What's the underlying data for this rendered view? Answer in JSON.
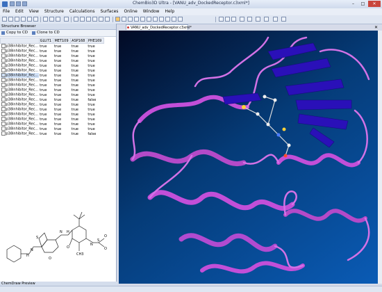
{
  "window": {
    "title": "ChemBio3D Ultra - [VANU_adv_DockedReceptor.c3xml*]"
  },
  "window_controls": {
    "minimize": "–",
    "maximize": "□",
    "close": "✕"
  },
  "menu": [
    "File",
    "Edit",
    "View",
    "Structure",
    "Calculations",
    "Surfaces",
    "Online",
    "Window",
    "Help"
  ],
  "structure_browser": {
    "title": "Structure Browser",
    "copy_to_cd": "Copy to CD",
    "clone_to_cd": "Clone to CD",
    "columns": [
      "",
      "GLU71",
      "MET109",
      "ASP168",
      "PHE169"
    ],
    "rows": [
      {
        "name": "p38inhibitor_Rec...",
        "v": [
          "true",
          "true",
          "true",
          "true"
        ]
      },
      {
        "name": "p38inhibitor_Rec...",
        "v": [
          "true",
          "true",
          "true",
          "true"
        ]
      },
      {
        "name": "p38inhibitor_Rec...",
        "v": [
          "true",
          "true",
          "true",
          "true"
        ]
      },
      {
        "name": "p38inhibitor_Rec...",
        "v": [
          "true",
          "true",
          "true",
          "true"
        ]
      },
      {
        "name": "p38inhibitor_Rec...",
        "v": [
          "true",
          "true",
          "true",
          "true"
        ]
      },
      {
        "name": "p38inhibitor_Rec...",
        "v": [
          "true",
          "true",
          "true",
          "true"
        ]
      },
      {
        "name": "p38inhibitor_Rec...",
        "v": [
          "true",
          "true",
          "true",
          "true"
        ]
      },
      {
        "name": "p38inhibitor_Rec...",
        "v": [
          "true",
          "true",
          "true",
          "true"
        ]
      },
      {
        "name": "p38inhibitor_Rec...",
        "v": [
          "true",
          "true",
          "true",
          "true"
        ]
      },
      {
        "name": "p38inhibitor_Rec...",
        "v": [
          "true",
          "true",
          "true",
          "true"
        ]
      },
      {
        "name": "p38inhibitor_Rec...",
        "v": [
          "true",
          "true",
          "true",
          "true"
        ]
      },
      {
        "name": "p38inhibitor_Rec...",
        "v": [
          "true",
          "true",
          "true",
          "false"
        ]
      },
      {
        "name": "p38inhibitor_Rec...",
        "v": [
          "true",
          "true",
          "true",
          "true"
        ]
      },
      {
        "name": "p38inhibitor_Rec...",
        "v": [
          "true",
          "true",
          "true",
          "true"
        ]
      },
      {
        "name": "p38inhibitor_Rec...",
        "v": [
          "true",
          "true",
          "true",
          "true"
        ]
      },
      {
        "name": "p38inhibitor_Rec...",
        "v": [
          "true",
          "true",
          "true",
          "true"
        ]
      },
      {
        "name": "p38inhibitor_Rec...",
        "v": [
          "true",
          "true",
          "true",
          "true"
        ]
      },
      {
        "name": "p38inhibitor_Rec...",
        "v": [
          "true",
          "true",
          "true",
          "true"
        ]
      },
      {
        "name": "p38inhibitor_Rec...",
        "v": [
          "true",
          "true",
          "true",
          "false"
        ]
      }
    ],
    "selected_row": 6
  },
  "preview": {
    "title": "ChemDraw Preview",
    "atoms": {
      "H": "H",
      "N": "N",
      "S": "S",
      "O": "O",
      "CH3": "CH3"
    }
  },
  "document_tab": {
    "label": "VANU_adv_DockedReceptor.c3xml*",
    "close": "✕"
  },
  "colors": {
    "helix": "#c24fd8",
    "sheet": "#2a10b8",
    "background_top": "#020a24",
    "background_bottom": "#0a5bb5"
  }
}
